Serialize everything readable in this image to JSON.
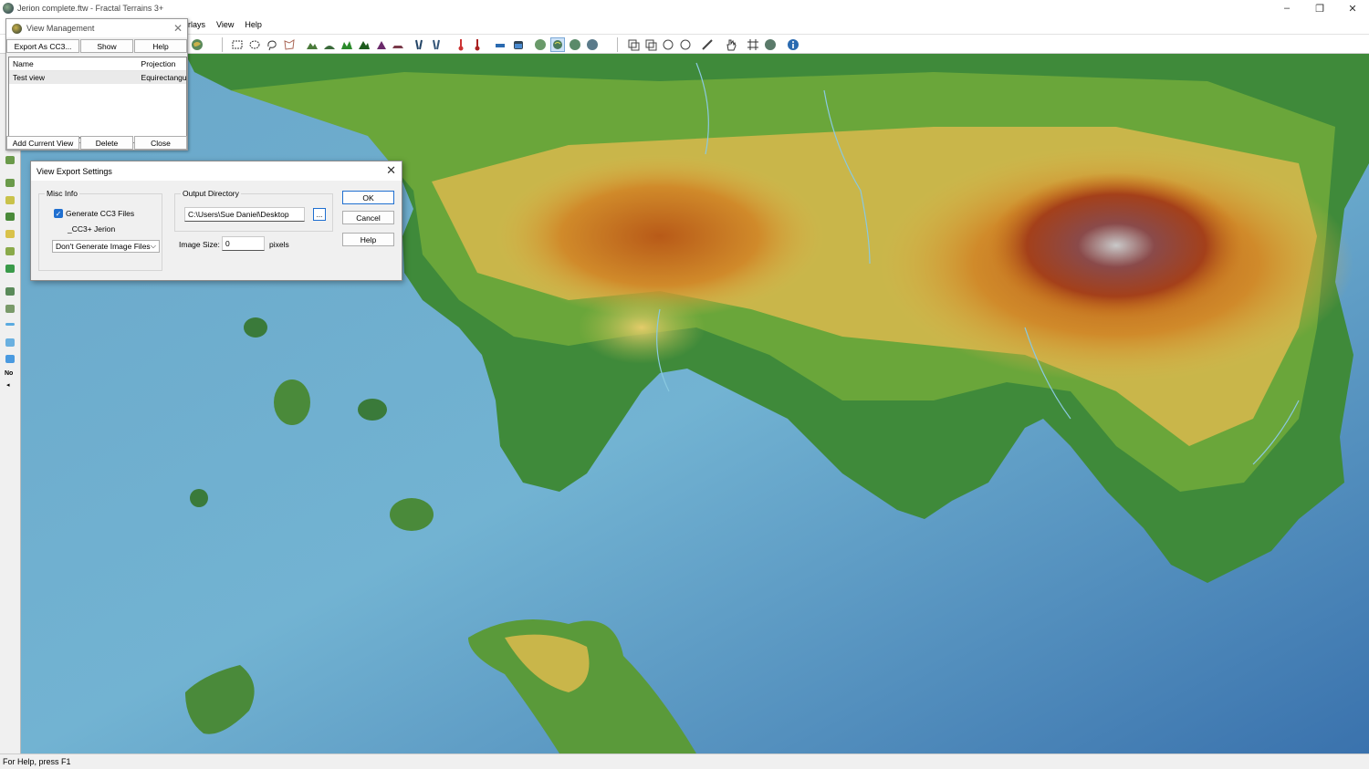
{
  "window": {
    "title": "Jerion complete.ftw - Fractal Terrains 3+",
    "controls": [
      "–",
      "❐",
      "✕"
    ]
  },
  "menu": {
    "items": [
      "rlays",
      "View",
      "Help"
    ]
  },
  "view_management": {
    "title": "View Management",
    "buttons_top": [
      "Export As CC3...",
      "Show",
      "Help"
    ],
    "columns": [
      "Name",
      "Projection"
    ],
    "rows": [
      {
        "name": "Test view",
        "projection": "Equirectangu"
      }
    ],
    "buttons_bottom": [
      "Add Current View",
      "Delete",
      "Close"
    ]
  },
  "export_dialog": {
    "title": "View Export Settings",
    "misc_info": {
      "group_label": "Misc Info",
      "generate_cc3_label": "Generate CC3 Files",
      "generate_cc3_checked": true,
      "prefix_label": "_CC3+ Jerion",
      "image_option": "Don't Generate Image Files"
    },
    "output": {
      "group_label": "Output Directory",
      "directory": "C:\\Users\\Sue Daniel\\Desktop",
      "browse_label": "...",
      "image_size_label": "Image Size:",
      "image_size_value": "0",
      "pixels_label": "pixels"
    },
    "buttons": [
      "OK",
      "Cancel",
      "Help"
    ]
  },
  "leftbar": {
    "no_label": "No",
    "arrow": "◂"
  },
  "status": {
    "text": "For Help, press F1"
  }
}
